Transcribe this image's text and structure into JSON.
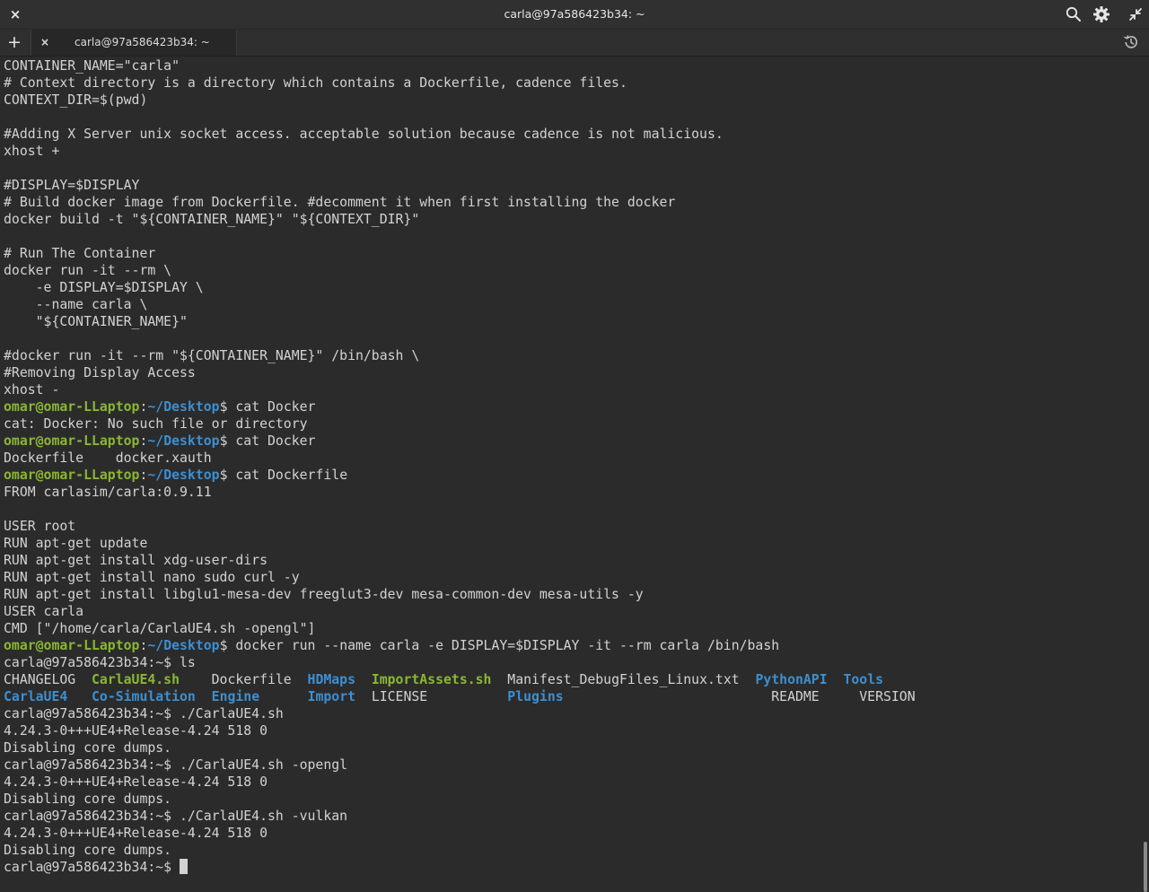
{
  "window": {
    "title": "carla@97a586423b34: ~",
    "close_icon": "×",
    "search_icon": "search-icon",
    "settings_icon": "gear-icon",
    "restore_icon": "restore-icon"
  },
  "tabbar": {
    "new_tab_label": "+",
    "tabs": [
      {
        "label": "carla@97a586423b34: ~",
        "close": "×"
      }
    ],
    "history_icon": "history-icon"
  },
  "colors": {
    "background": "#2b2b2b",
    "text": "#d2d2d2",
    "prompt_user": "#8ab733",
    "prompt_path": "#3d8fd1",
    "directory": "#3d8fd1",
    "executable": "#8ab733"
  },
  "terminal": {
    "lines": [
      {
        "segments": [
          {
            "text": "CONTAINER_NAME=\"carla\""
          }
        ]
      },
      {
        "segments": [
          {
            "text": "# Context directory is a directory which contains a Dockerfile, cadence files."
          }
        ]
      },
      {
        "segments": [
          {
            "text": "CONTEXT_DIR=$(pwd)"
          }
        ]
      },
      {
        "segments": [
          {
            "text": ""
          }
        ]
      },
      {
        "segments": [
          {
            "text": "#Adding X Server unix socket access. acceptable solution because cadence is not malicious."
          }
        ]
      },
      {
        "segments": [
          {
            "text": "xhost +"
          }
        ]
      },
      {
        "segments": [
          {
            "text": ""
          }
        ]
      },
      {
        "segments": [
          {
            "text": "#DISPLAY=$DISPLAY"
          }
        ]
      },
      {
        "segments": [
          {
            "text": "# Build docker image from Dockerfile. #decomment it when first installing the docker"
          }
        ]
      },
      {
        "segments": [
          {
            "text": "docker build -t \"${CONTAINER_NAME}\" \"${CONTEXT_DIR}\""
          }
        ]
      },
      {
        "segments": [
          {
            "text": ""
          }
        ]
      },
      {
        "segments": [
          {
            "text": "# Run The Container"
          }
        ]
      },
      {
        "segments": [
          {
            "text": "docker run -it --rm \\"
          }
        ]
      },
      {
        "segments": [
          {
            "text": "    -e DISPLAY=$DISPLAY \\"
          }
        ]
      },
      {
        "segments": [
          {
            "text": "    --name carla \\"
          }
        ]
      },
      {
        "segments": [
          {
            "text": "    \"${CONTAINER_NAME}\""
          }
        ]
      },
      {
        "segments": [
          {
            "text": ""
          }
        ]
      },
      {
        "segments": [
          {
            "text": "#docker run -it --rm \"${CONTAINER_NAME}\" /bin/bash \\"
          }
        ]
      },
      {
        "segments": [
          {
            "text": "#Removing Display Access"
          }
        ]
      },
      {
        "segments": [
          {
            "text": "xhost -"
          }
        ]
      },
      {
        "segments": [
          {
            "text": "omar@omar-LLaptop",
            "style": "user"
          },
          {
            "text": ":"
          },
          {
            "text": "~/Desktop",
            "style": "path"
          },
          {
            "text": "$ cat Docker"
          }
        ]
      },
      {
        "segments": [
          {
            "text": "cat: Docker: No such file or directory"
          }
        ]
      },
      {
        "segments": [
          {
            "text": "omar@omar-LLaptop",
            "style": "user"
          },
          {
            "text": ":"
          },
          {
            "text": "~/Desktop",
            "style": "path"
          },
          {
            "text": "$ cat Docker"
          }
        ]
      },
      {
        "segments": [
          {
            "text": "Dockerfile    docker.xauth"
          }
        ]
      },
      {
        "segments": [
          {
            "text": "omar@omar-LLaptop",
            "style": "user"
          },
          {
            "text": ":"
          },
          {
            "text": "~/Desktop",
            "style": "path"
          },
          {
            "text": "$ cat Dockerfile"
          }
        ]
      },
      {
        "segments": [
          {
            "text": "FROM carlasim/carla:0.9.11"
          }
        ]
      },
      {
        "segments": [
          {
            "text": ""
          }
        ]
      },
      {
        "segments": [
          {
            "text": "USER root"
          }
        ]
      },
      {
        "segments": [
          {
            "text": "RUN apt-get update"
          }
        ]
      },
      {
        "segments": [
          {
            "text": "RUN apt-get install xdg-user-dirs"
          }
        ]
      },
      {
        "segments": [
          {
            "text": "RUN apt-get install nano sudo curl -y"
          }
        ]
      },
      {
        "segments": [
          {
            "text": "RUN apt-get install libglu1-mesa-dev freeglut3-dev mesa-common-dev mesa-utils -y"
          }
        ]
      },
      {
        "segments": [
          {
            "text": "USER carla"
          }
        ]
      },
      {
        "segments": [
          {
            "text": "CMD [\"/home/carla/CarlaUE4.sh -opengl\"]"
          }
        ]
      },
      {
        "segments": [
          {
            "text": "omar@omar-LLaptop",
            "style": "user"
          },
          {
            "text": ":"
          },
          {
            "text": "~/Desktop",
            "style": "path"
          },
          {
            "text": "$ docker run --name carla -e DISPLAY=$DISPLAY -it --rm carla /bin/bash"
          }
        ]
      },
      {
        "segments": [
          {
            "text": "carla@97a586423b34:~$ ls"
          }
        ]
      },
      {
        "segments": [
          {
            "text": "CHANGELOG  "
          },
          {
            "text": "CarlaUE4.sh",
            "style": "exec"
          },
          {
            "text": "    Dockerfile  "
          },
          {
            "text": "HDMaps",
            "style": "dir"
          },
          {
            "text": "  "
          },
          {
            "text": "ImportAssets.sh",
            "style": "exec"
          },
          {
            "text": "  Manifest_DebugFiles_Linux.txt  "
          },
          {
            "text": "PythonAPI",
            "style": "dir"
          },
          {
            "text": "  "
          },
          {
            "text": "Tools",
            "style": "dir"
          }
        ]
      },
      {
        "segments": [
          {
            "text": "CarlaUE4",
            "style": "dir"
          },
          {
            "text": "   "
          },
          {
            "text": "Co-Simulation",
            "style": "dir"
          },
          {
            "text": "  "
          },
          {
            "text": "Engine",
            "style": "dir"
          },
          {
            "text": "      "
          },
          {
            "text": "Import",
            "style": "dir"
          },
          {
            "text": "  LICENSE          "
          },
          {
            "text": "Plugins",
            "style": "dir"
          },
          {
            "text": "                          README     VERSION"
          }
        ]
      },
      {
        "segments": [
          {
            "text": "carla@97a586423b34:~$ ./CarlaUE4.sh"
          }
        ]
      },
      {
        "segments": [
          {
            "text": "4.24.3-0+++UE4+Release-4.24 518 0"
          }
        ]
      },
      {
        "segments": [
          {
            "text": "Disabling core dumps."
          }
        ]
      },
      {
        "segments": [
          {
            "text": "carla@97a586423b34:~$ ./CarlaUE4.sh -opengl"
          }
        ]
      },
      {
        "segments": [
          {
            "text": "4.24.3-0+++UE4+Release-4.24 518 0"
          }
        ]
      },
      {
        "segments": [
          {
            "text": "Disabling core dumps."
          }
        ]
      },
      {
        "segments": [
          {
            "text": "carla@97a586423b34:~$ ./CarlaUE4.sh -vulkan"
          }
        ]
      },
      {
        "segments": [
          {
            "text": "4.24.3-0+++UE4+Release-4.24 518 0"
          }
        ]
      },
      {
        "segments": [
          {
            "text": "Disabling core dumps."
          }
        ]
      },
      {
        "segments": [
          {
            "text": "carla@97a586423b34:~$ "
          }
        ],
        "cursor": true
      }
    ]
  }
}
